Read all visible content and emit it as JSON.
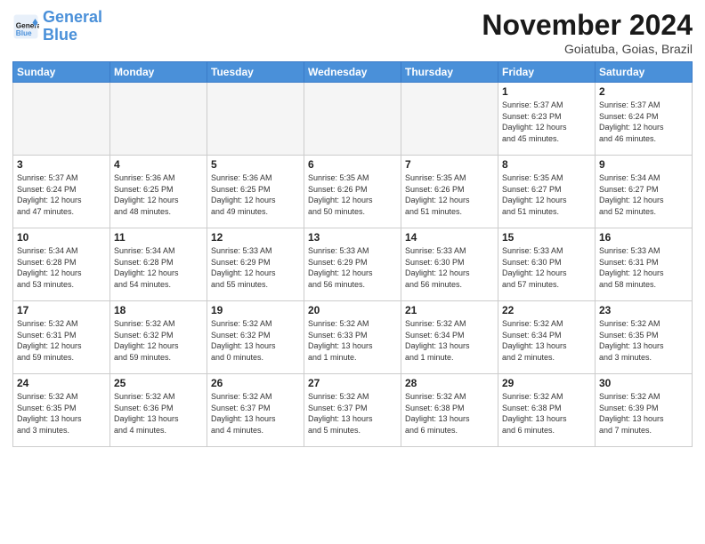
{
  "logo": {
    "line1": "General",
    "line2": "Blue"
  },
  "title": "November 2024",
  "location": "Goiatuba, Goias, Brazil",
  "weekdays": [
    "Sunday",
    "Monday",
    "Tuesday",
    "Wednesday",
    "Thursday",
    "Friday",
    "Saturday"
  ],
  "weeks": [
    [
      {
        "day": "",
        "info": ""
      },
      {
        "day": "",
        "info": ""
      },
      {
        "day": "",
        "info": ""
      },
      {
        "day": "",
        "info": ""
      },
      {
        "day": "",
        "info": ""
      },
      {
        "day": "1",
        "info": "Sunrise: 5:37 AM\nSunset: 6:23 PM\nDaylight: 12 hours\nand 45 minutes."
      },
      {
        "day": "2",
        "info": "Sunrise: 5:37 AM\nSunset: 6:24 PM\nDaylight: 12 hours\nand 46 minutes."
      }
    ],
    [
      {
        "day": "3",
        "info": "Sunrise: 5:37 AM\nSunset: 6:24 PM\nDaylight: 12 hours\nand 47 minutes."
      },
      {
        "day": "4",
        "info": "Sunrise: 5:36 AM\nSunset: 6:25 PM\nDaylight: 12 hours\nand 48 minutes."
      },
      {
        "day": "5",
        "info": "Sunrise: 5:36 AM\nSunset: 6:25 PM\nDaylight: 12 hours\nand 49 minutes."
      },
      {
        "day": "6",
        "info": "Sunrise: 5:35 AM\nSunset: 6:26 PM\nDaylight: 12 hours\nand 50 minutes."
      },
      {
        "day": "7",
        "info": "Sunrise: 5:35 AM\nSunset: 6:26 PM\nDaylight: 12 hours\nand 51 minutes."
      },
      {
        "day": "8",
        "info": "Sunrise: 5:35 AM\nSunset: 6:27 PM\nDaylight: 12 hours\nand 51 minutes."
      },
      {
        "day": "9",
        "info": "Sunrise: 5:34 AM\nSunset: 6:27 PM\nDaylight: 12 hours\nand 52 minutes."
      }
    ],
    [
      {
        "day": "10",
        "info": "Sunrise: 5:34 AM\nSunset: 6:28 PM\nDaylight: 12 hours\nand 53 minutes."
      },
      {
        "day": "11",
        "info": "Sunrise: 5:34 AM\nSunset: 6:28 PM\nDaylight: 12 hours\nand 54 minutes."
      },
      {
        "day": "12",
        "info": "Sunrise: 5:33 AM\nSunset: 6:29 PM\nDaylight: 12 hours\nand 55 minutes."
      },
      {
        "day": "13",
        "info": "Sunrise: 5:33 AM\nSunset: 6:29 PM\nDaylight: 12 hours\nand 56 minutes."
      },
      {
        "day": "14",
        "info": "Sunrise: 5:33 AM\nSunset: 6:30 PM\nDaylight: 12 hours\nand 56 minutes."
      },
      {
        "day": "15",
        "info": "Sunrise: 5:33 AM\nSunset: 6:30 PM\nDaylight: 12 hours\nand 57 minutes."
      },
      {
        "day": "16",
        "info": "Sunrise: 5:33 AM\nSunset: 6:31 PM\nDaylight: 12 hours\nand 58 minutes."
      }
    ],
    [
      {
        "day": "17",
        "info": "Sunrise: 5:32 AM\nSunset: 6:31 PM\nDaylight: 12 hours\nand 59 minutes."
      },
      {
        "day": "18",
        "info": "Sunrise: 5:32 AM\nSunset: 6:32 PM\nDaylight: 12 hours\nand 59 minutes."
      },
      {
        "day": "19",
        "info": "Sunrise: 5:32 AM\nSunset: 6:32 PM\nDaylight: 13 hours\nand 0 minutes."
      },
      {
        "day": "20",
        "info": "Sunrise: 5:32 AM\nSunset: 6:33 PM\nDaylight: 13 hours\nand 1 minute."
      },
      {
        "day": "21",
        "info": "Sunrise: 5:32 AM\nSunset: 6:34 PM\nDaylight: 13 hours\nand 1 minute."
      },
      {
        "day": "22",
        "info": "Sunrise: 5:32 AM\nSunset: 6:34 PM\nDaylight: 13 hours\nand 2 minutes."
      },
      {
        "day": "23",
        "info": "Sunrise: 5:32 AM\nSunset: 6:35 PM\nDaylight: 13 hours\nand 3 minutes."
      }
    ],
    [
      {
        "day": "24",
        "info": "Sunrise: 5:32 AM\nSunset: 6:35 PM\nDaylight: 13 hours\nand 3 minutes."
      },
      {
        "day": "25",
        "info": "Sunrise: 5:32 AM\nSunset: 6:36 PM\nDaylight: 13 hours\nand 4 minutes."
      },
      {
        "day": "26",
        "info": "Sunrise: 5:32 AM\nSunset: 6:37 PM\nDaylight: 13 hours\nand 4 minutes."
      },
      {
        "day": "27",
        "info": "Sunrise: 5:32 AM\nSunset: 6:37 PM\nDaylight: 13 hours\nand 5 minutes."
      },
      {
        "day": "28",
        "info": "Sunrise: 5:32 AM\nSunset: 6:38 PM\nDaylight: 13 hours\nand 6 minutes."
      },
      {
        "day": "29",
        "info": "Sunrise: 5:32 AM\nSunset: 6:38 PM\nDaylight: 13 hours\nand 6 minutes."
      },
      {
        "day": "30",
        "info": "Sunrise: 5:32 AM\nSunset: 6:39 PM\nDaylight: 13 hours\nand 7 minutes."
      }
    ]
  ]
}
